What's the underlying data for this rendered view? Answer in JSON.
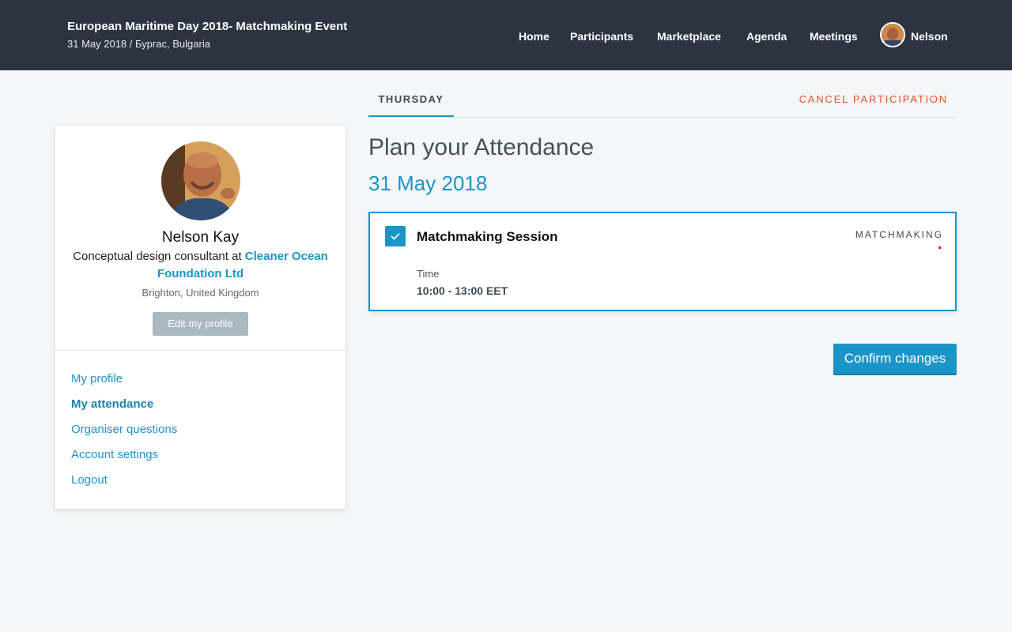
{
  "header": {
    "event_title": "European Maritime Day 2018- Matchmaking Event",
    "event_subtitle": "31 May 2018 / Бургас, Bulgaria",
    "nav": {
      "home": "Home",
      "participants": "Participants",
      "marketplace": "Marketplace",
      "agenda": "Agenda",
      "meetings": "Meetings"
    },
    "user_name": "Nelson"
  },
  "profile": {
    "name": "Nelson Kay",
    "role_prefix": "Conceptual design consultant at ",
    "organisation": "Cleaner Ocean Foundation Ltd",
    "location": "Brighton, United Kingdom",
    "edit_label": "Edit my profile"
  },
  "menu": {
    "my_profile": "My profile",
    "my_attendance": "My attendance",
    "organiser_questions": "Organiser questions",
    "account_settings": "Account settings",
    "logout": "Logout"
  },
  "tabs": {
    "day": "THURSDAY",
    "cancel": "CANCEL PARTICIPATION"
  },
  "main": {
    "title": "Plan your Attendance",
    "date": "31 May 2018"
  },
  "session": {
    "name": "Matchmaking Session",
    "tag": "MATCHMAKING",
    "time_label": "Time",
    "time_value": "10:00 - 13:00 EET",
    "checked": true
  },
  "actions": {
    "confirm": "Confirm changes"
  },
  "colors": {
    "header_bg": "#2c3442",
    "accent": "#1b95c8",
    "cancel": "#e8502a"
  }
}
